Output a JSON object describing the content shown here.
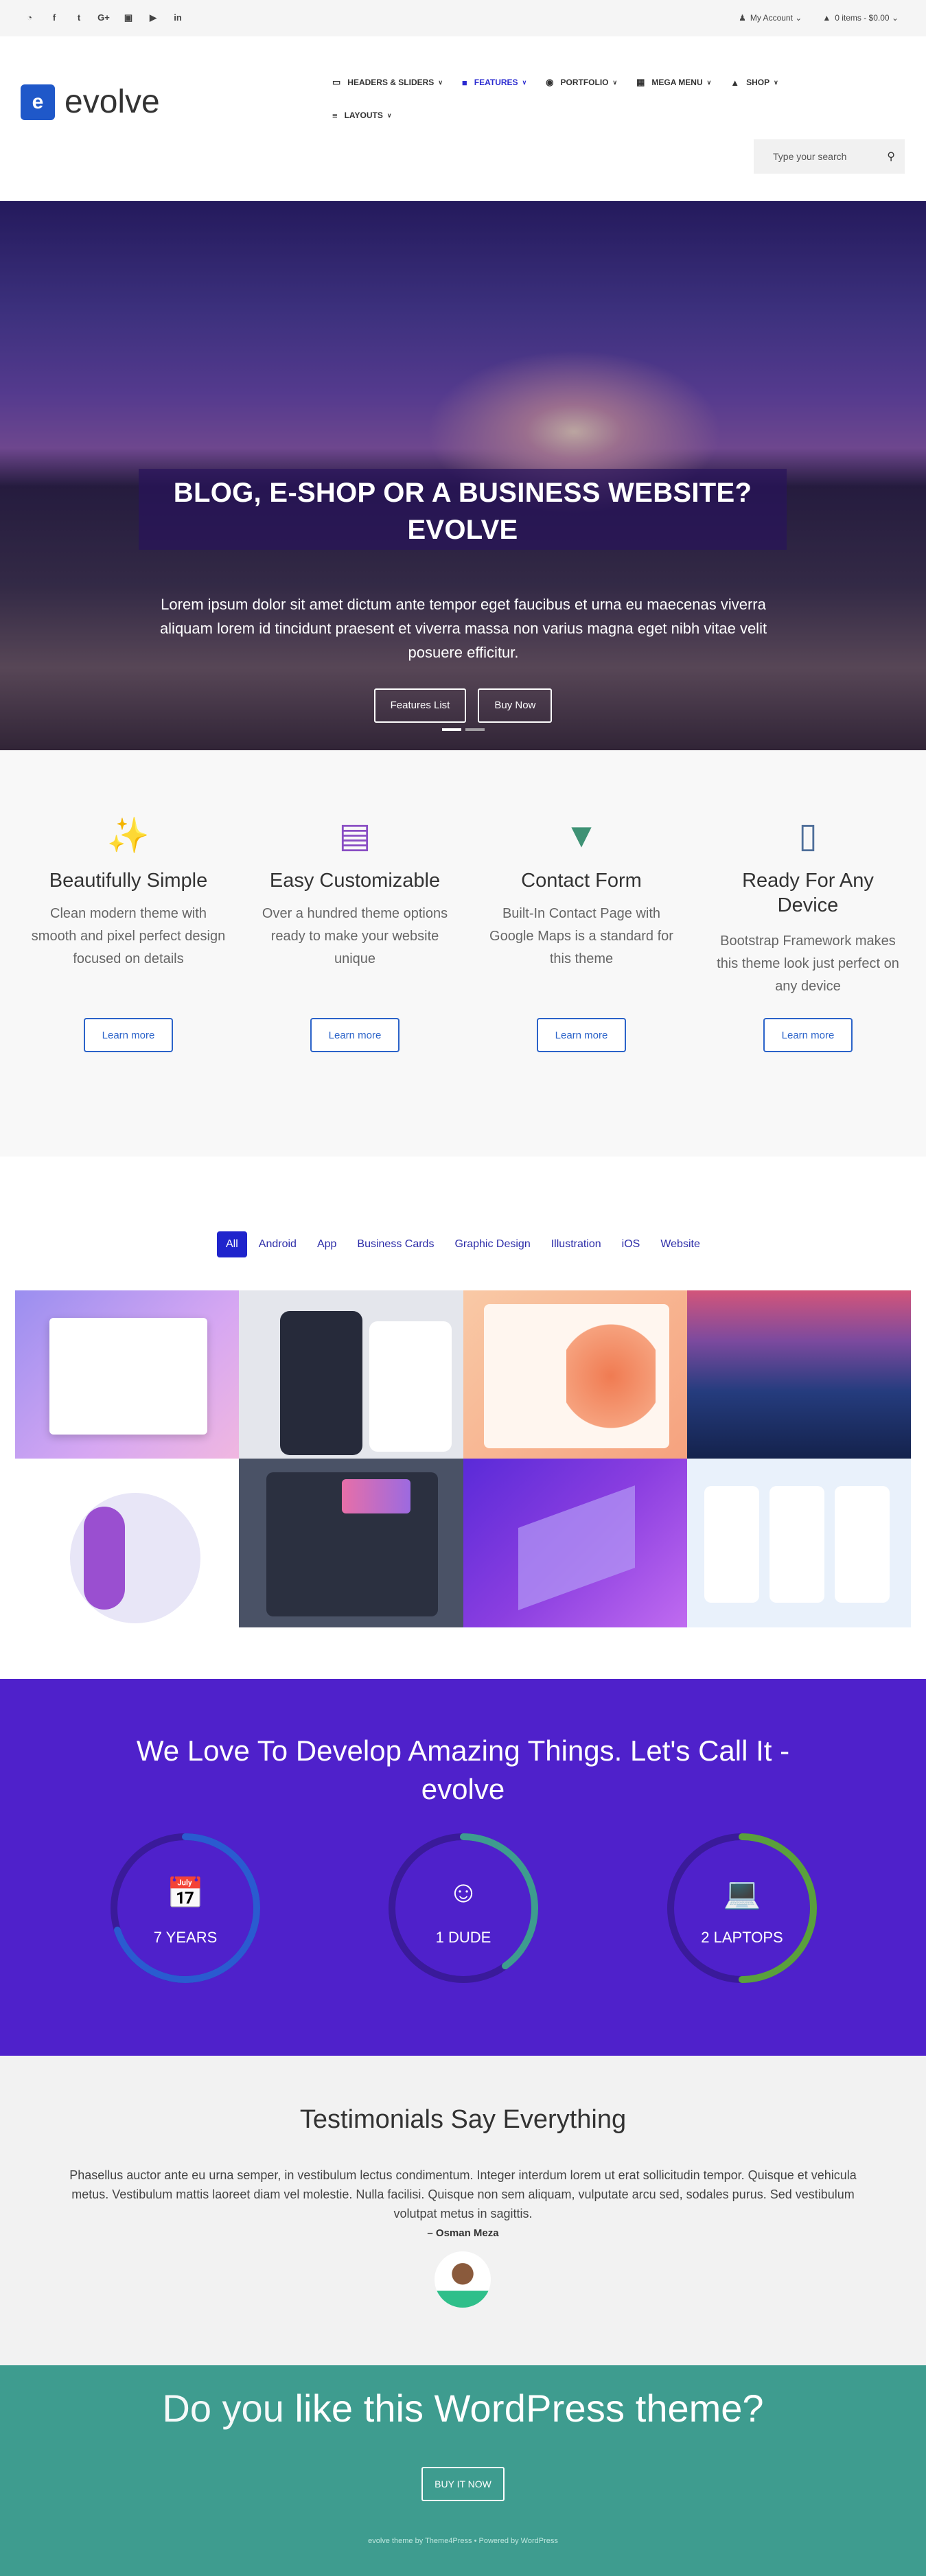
{
  "topbar": {
    "social": [
      {
        "icon": "rss-icon",
        "glyph": "◔"
      },
      {
        "icon": "facebook-icon",
        "glyph": "f"
      },
      {
        "icon": "twitter-icon",
        "glyph": "t"
      },
      {
        "icon": "google-plus-icon",
        "glyph": "G+"
      },
      {
        "icon": "instagram-icon",
        "glyph": "▣"
      },
      {
        "icon": "youtube-icon",
        "glyph": "▶"
      },
      {
        "icon": "linkedin-icon",
        "glyph": "in"
      }
    ],
    "account": "My Account",
    "cart": "0 items - $0.00"
  },
  "header": {
    "logo_text": "evolve",
    "nav": [
      {
        "label": "Headers & Sliders",
        "icon": "monitor-icon",
        "glyph": "▭"
      },
      {
        "label": "Features",
        "icon": "book-icon",
        "glyph": "■",
        "active": true
      },
      {
        "label": "Portfolio",
        "icon": "camera-icon",
        "glyph": "◉"
      },
      {
        "label": "Mega Menu",
        "icon": "grid-icon",
        "glyph": "▦"
      },
      {
        "label": "Shop",
        "icon": "bag-icon",
        "glyph": "▲"
      },
      {
        "label": "Layouts",
        "icon": "sliders-icon",
        "glyph": "≡"
      }
    ],
    "search_placeholder": "Type your search"
  },
  "hero": {
    "title": "BLOG, E-SHOP OR A BUSINESS WEBSITE? EVOLVE",
    "text": "Lorem ipsum dolor sit amet dictum ante tempor eget faucibus et urna eu maecenas viverra aliquam lorem id tincidunt praesent et viverra massa non varius magna eget nibh vitae velit posuere efficitur.",
    "buttons": [
      "Features List",
      "Buy Now"
    ],
    "slides": 2,
    "active_slide": 1
  },
  "features": [
    {
      "icon": "magic-wand-icon",
      "glyph": "✨",
      "color": "#3f5ba9",
      "title": "Beautifully Simple",
      "text": "Clean modern theme with smooth and pixel perfect design focused on details",
      "button": "Learn more"
    },
    {
      "icon": "toolbox-icon",
      "glyph": "▤",
      "color": "#8a4fc4",
      "title": "Easy Customizable",
      "text": "Over a hundred theme options ready to make your website unique",
      "button": "Learn more"
    },
    {
      "icon": "map-marker-icon",
      "glyph": "▼",
      "color": "#3f9275",
      "title": "Contact Form",
      "text": "Built-In Contact Page with Google Maps is a standard for this theme",
      "button": "Learn more"
    },
    {
      "icon": "tablet-icon",
      "glyph": "▯",
      "color": "#4f6f9a",
      "title": "Ready For Any Device",
      "text": "Bootstrap Framework makes this theme look just perfect on any device",
      "button": "Learn more"
    }
  ],
  "portfolio": {
    "filters": [
      "All",
      "Android",
      "App",
      "Business Cards",
      "Graphic Design",
      "Illustration",
      "iOS",
      "Website"
    ],
    "active_filter": "All"
  },
  "counters": {
    "title": "We Love To Develop Amazing Things. Let's Call It - evolve",
    "items": [
      {
        "label": "7 YEARS",
        "icon": "calendar-check-icon",
        "glyph": "📅",
        "percent": 70,
        "color": "#2a5bd0"
      },
      {
        "label": "1 DUDE",
        "icon": "smile-icon",
        "glyph": "☺",
        "percent": 40,
        "color": "#3e9c8f"
      },
      {
        "label": "2 LAPTOPS",
        "icon": "laptop-icon",
        "glyph": "💻",
        "percent": 50,
        "color": "#5aa03c"
      }
    ]
  },
  "testimonials": {
    "title": "Testimonials Say Everything",
    "quote": "Phasellus auctor ante eu urna semper, in vestibulum lectus condimentum. Integer interdum lorem ut erat sollicitudin tempor. Quisque et vehicula metus. Vestibulum mattis laoreet diam vel molestie. Nulla facilisi. Quisque non sem aliquam, vulputate arcu sed, sodales purus. Sed vestibulum volutpat metus in sagittis.",
    "author": "– Osman Meza"
  },
  "cta": {
    "pre": "Do you ",
    "like": "like",
    "mid": " this ",
    "wp": "WordPress",
    "post": " theme?",
    "button": "BUY IT NOW",
    "footer": "evolve theme by Theme4Press  •  Powered by WordPress"
  }
}
